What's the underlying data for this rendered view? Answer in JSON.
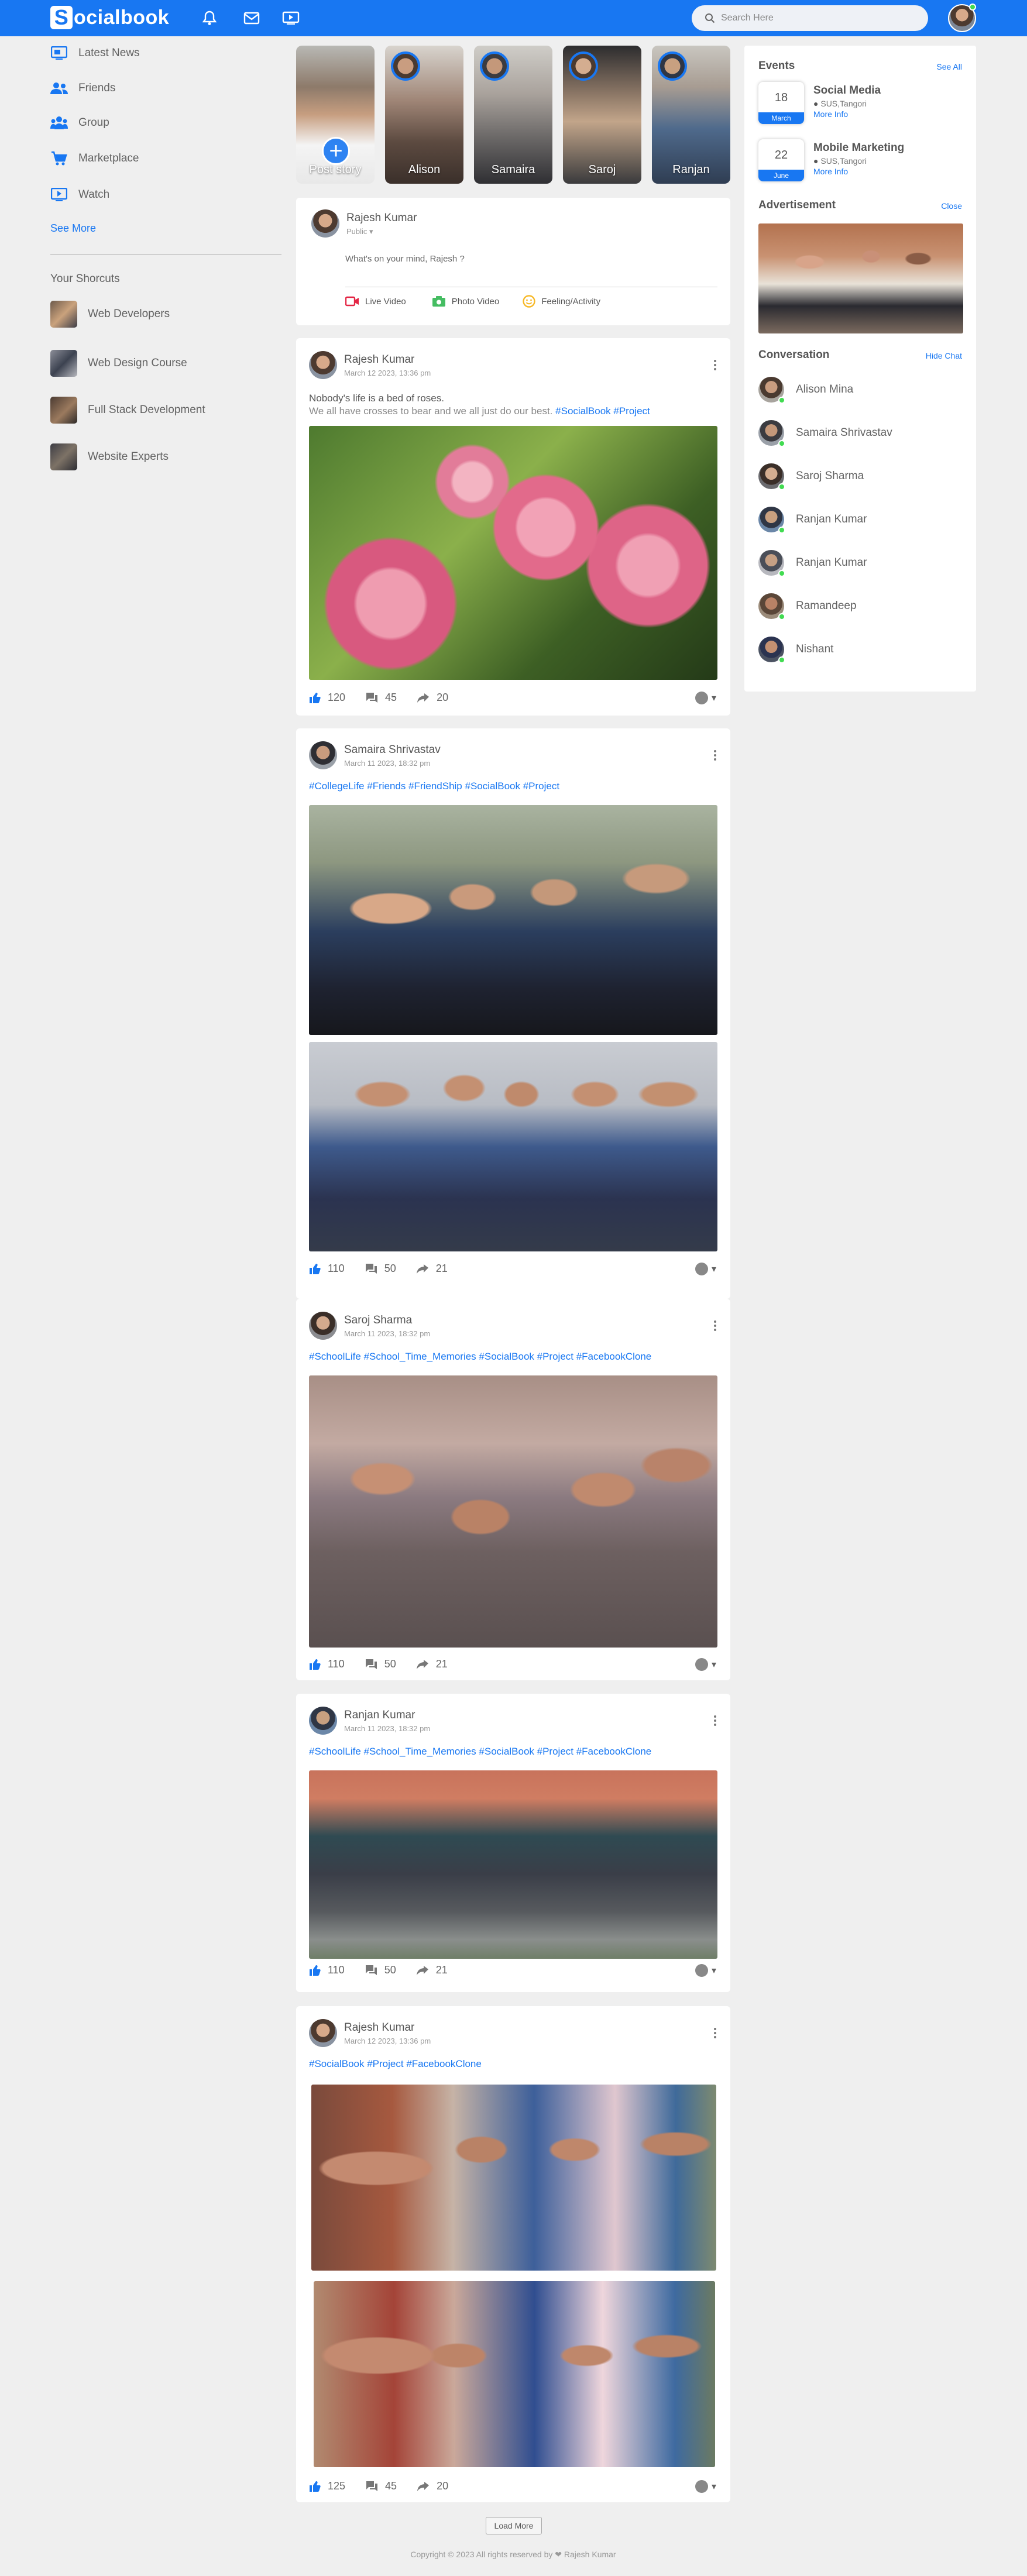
{
  "nav": {
    "logo_letter": "S",
    "logo_rest": "ocialbook",
    "search_placeholder": "Search Here",
    "icons": [
      "bell-icon",
      "mail-icon",
      "video-icon",
      "search-icon"
    ]
  },
  "left": {
    "items": [
      {
        "label": "Latest News",
        "icon": "news-icon"
      },
      {
        "label": "Friends",
        "icon": "friends-icon"
      },
      {
        "label": "Group",
        "icon": "group-icon"
      },
      {
        "label": "Marketplace",
        "icon": "cart-icon"
      },
      {
        "label": "Watch",
        "icon": "watch-icon"
      }
    ],
    "see_more": "See More",
    "shortcuts_title": "Your Shorcuts",
    "shortcuts": [
      {
        "label": "Web Developers"
      },
      {
        "label": "Web Design Course"
      },
      {
        "label": "Full Stack Development"
      },
      {
        "label": "Website Experts"
      }
    ]
  },
  "stories": [
    {
      "name": "Post story",
      "plus": "+"
    },
    {
      "name": "Alison"
    },
    {
      "name": "Samaira"
    },
    {
      "name": "Saroj"
    },
    {
      "name": "Ranjan"
    }
  ],
  "composer": {
    "name": "Rajesh Kumar",
    "privacy": "Public",
    "placeholder": "What's on your mind, Rajesh ?",
    "live": "Live Video",
    "photo": "Photo Video",
    "feeling": "Feeling/Activity"
  },
  "posts": [
    {
      "name": "Rajesh Kumar",
      "date": "March 12 2023, 13:36 pm",
      "line1": "Nobody's life is a bed of roses.",
      "line2": "We all have crosses to bear and we all just do our best.",
      "tags": "#SocialBook #Project",
      "likes": "120",
      "comments": "45",
      "shares": "20"
    },
    {
      "name": "Samaira Shrivastav",
      "date": "March 11 2023, 18:32 pm",
      "tags": "#CollegeLife #Friends #FriendShip #SocialBook #Project",
      "likes": "110",
      "comments": "50",
      "shares": "21"
    },
    {
      "name": "Saroj Sharma",
      "date": "March 11 2023, 18:32 pm",
      "tags": "#SchoolLife #School_Time_Memories #SocialBook #Project #FacebookClone",
      "likes": "110",
      "comments": "50",
      "shares": "21"
    },
    {
      "name": "Ranjan Kumar",
      "date": "March 11 2023, 18:32 pm",
      "tags": "#SchoolLife #School_Time_Memories #SocialBook #Project #FacebookClone",
      "likes": "110",
      "comments": "50",
      "shares": "21"
    },
    {
      "name": "Rajesh Kumar",
      "date": "March 12 2023, 13:36 pm",
      "tags": "#SocialBook #Project #FacebookClone",
      "likes": "125",
      "comments": "45",
      "shares": "20"
    }
  ],
  "load_more": "Load More",
  "footer": "Copyright © 2023 All rights reserved by ❤ Rajesh Kumar",
  "right": {
    "events_title": "Events",
    "see_all": "See All",
    "events": [
      {
        "day": "18",
        "month": "March",
        "title": "Social Media",
        "location": "SUS,Tangori",
        "more": "More Info"
      },
      {
        "day": "22",
        "month": "June",
        "title": "Mobile Marketing",
        "location": "SUS,Tangori",
        "more": "More Info"
      }
    ],
    "ad_title": "Advertisement",
    "ad_close": "Close",
    "convo_title": "Conversation",
    "hide_chat": "Hide Chat",
    "contacts": [
      {
        "name": "Alison Mina"
      },
      {
        "name": "Samaira Shrivastav"
      },
      {
        "name": "Saroj Sharma"
      },
      {
        "name": "Ranjan Kumar"
      },
      {
        "name": "Ranjan Kumar"
      },
      {
        "name": "Ramandeep"
      },
      {
        "name": "Nishant"
      }
    ]
  },
  "colors": {
    "brand": "#1877f2",
    "online": "#41db51",
    "background": "#efefef"
  }
}
